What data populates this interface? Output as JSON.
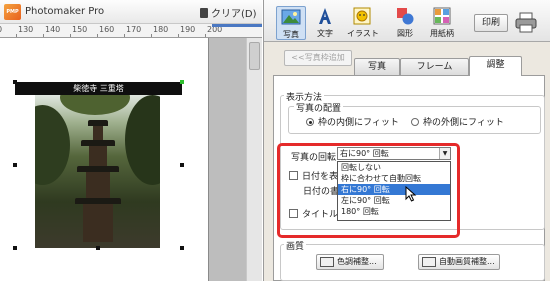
{
  "app": {
    "title": "Photomaker Pro",
    "logo_text": "PMP",
    "clear_label": "クリア(D)"
  },
  "ruler": {
    "ticks": [
      "0",
      "130",
      "140",
      "150",
      "160",
      "170",
      "180",
      "190",
      "200"
    ]
  },
  "photo": {
    "caption": "柴徳寺 三重塔"
  },
  "toolbar": {
    "items": [
      {
        "label": "写真",
        "icon": "photo-icon"
      },
      {
        "label": "文字",
        "icon": "text-icon"
      },
      {
        "label": "イラスト",
        "icon": "illustration-icon"
      },
      {
        "label": "図形",
        "icon": "shapes-icon"
      },
      {
        "label": "用紙柄",
        "icon": "paper-pattern-icon"
      }
    ],
    "print_label": "印刷",
    "printer_icon": "printer-icon"
  },
  "panel": {
    "frame_add_button": "<<写真枠追加",
    "tabs": [
      "写真",
      "フレーム",
      "調整"
    ],
    "active_tab": "調整",
    "display_method_label": "表示方法",
    "placement_label": "写真の配置",
    "placement_options": [
      "枠の内側にフィット",
      "枠の外側にフィット"
    ],
    "placement_selected": "枠の内側にフィット",
    "rotation_label": "写真の回転",
    "rotation_value": "右に90° 回転",
    "rotation_options": [
      "回転しない",
      "枠に合わせて自動回転",
      "右に90° 回転",
      "左に90° 回転",
      "180° 回転"
    ],
    "rotation_highlighted": "右に90° 回転",
    "date_checkbox_label": "日付を表示",
    "date_style_label": "日付の書",
    "title_checkbox_label": "タイトルを",
    "image_quality_label": "画質",
    "color_adjust_button": "色調補整...",
    "auto_quality_button": "自動画質補整..."
  },
  "colors": {
    "highlight_outline": "#e52a2a",
    "selected_option": "#3478d4",
    "ruler_accent": "#4a78c2"
  }
}
